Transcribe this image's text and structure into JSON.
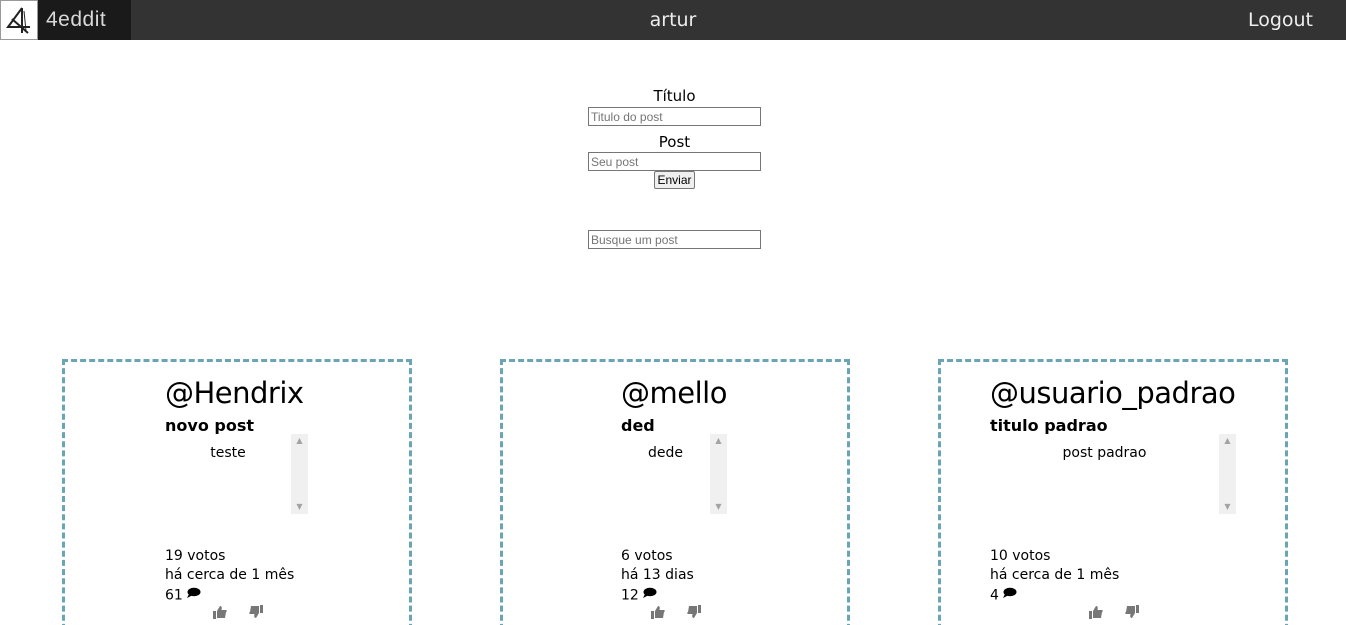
{
  "header": {
    "logo_text": "4eddit",
    "username": "artur",
    "logout_label": "Logout"
  },
  "form": {
    "title_label": "Título",
    "title_placeholder": "Titulo do post",
    "post_label": "Post",
    "post_placeholder": "Seu post",
    "submit_label": "Enviar",
    "search_placeholder": "Busque um post"
  },
  "posts": [
    {
      "author": "@Hendrix",
      "title": "novo post",
      "body": "teste",
      "votes": "19 votos",
      "time": "há cerca de 1 mês",
      "comments": "61"
    },
    {
      "author": "@mello",
      "title": "ded",
      "body": "dede",
      "votes": "6 votos",
      "time": "há 13 dias",
      "comments": "12"
    },
    {
      "author": "@usuario_padrao",
      "title": "titulo padrao",
      "body": "post padrao",
      "votes": "10 votos",
      "time": "há cerca de 1 mês",
      "comments": "4"
    }
  ],
  "colors": {
    "header_bg": "#333333",
    "card_border": "#6aa5b6"
  },
  "icons": {
    "comment": "speech-bubble-icon",
    "upvote": "thumbs-up-icon",
    "downvote": "thumbs-down-icon"
  }
}
